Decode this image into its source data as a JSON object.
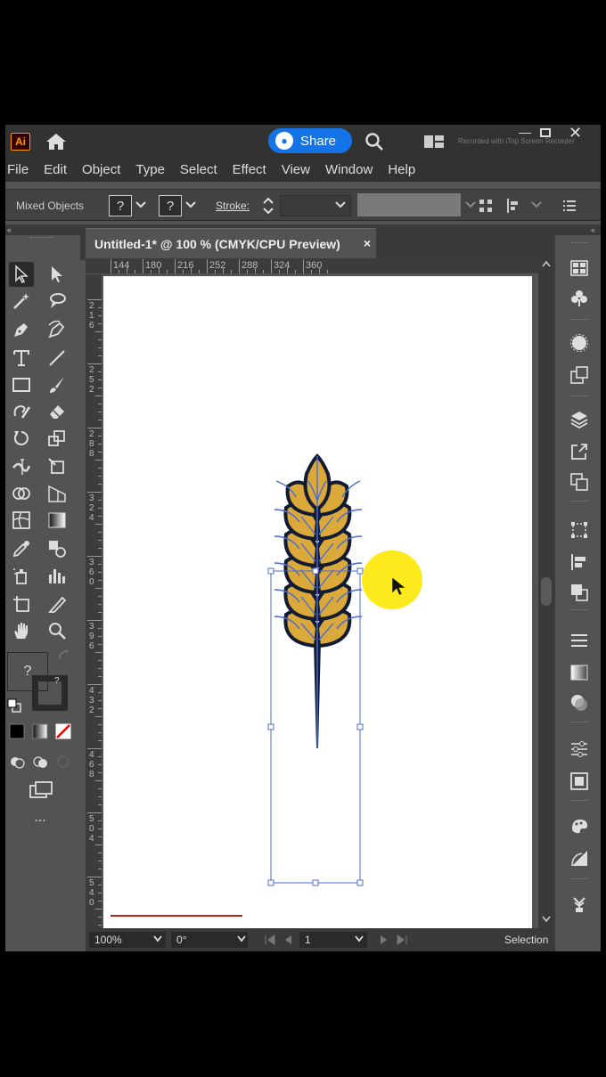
{
  "titlebar": {
    "app_logo": "Ai",
    "share_label": "Share",
    "watermark": "Recorded with iTop Screen Recorder"
  },
  "menu": [
    "File",
    "Edit",
    "Object",
    "Type",
    "Select",
    "Effect",
    "View",
    "Window",
    "Help"
  ],
  "control_bar": {
    "selection_label": "Mixed Objects",
    "fill_value": "?",
    "stroke_value": "?",
    "stroke_label": "Stroke:"
  },
  "document": {
    "tab_title": "Untitled-1* @ 100 % (CMYK/CPU Preview)",
    "close_glyph": "×"
  },
  "ruler_top": [
    "144",
    "180",
    "216",
    "252",
    "288",
    "324",
    "360"
  ],
  "ruler_left": [
    "216",
    "252",
    "288",
    "324",
    "360",
    "396",
    "432",
    "468",
    "504",
    "540"
  ],
  "toolbar": {
    "fill_q": "?",
    "stroke_q": "?",
    "more": "..."
  },
  "statusbar": {
    "zoom": "100%",
    "rotation": "0°",
    "artboard": "1",
    "tool": "Selection"
  },
  "colors": {
    "accent": "#1473e6",
    "selection_blue": "#4a6cd4",
    "wheat_gold": "#dba83a",
    "cursor_highlight": "#fde910"
  }
}
